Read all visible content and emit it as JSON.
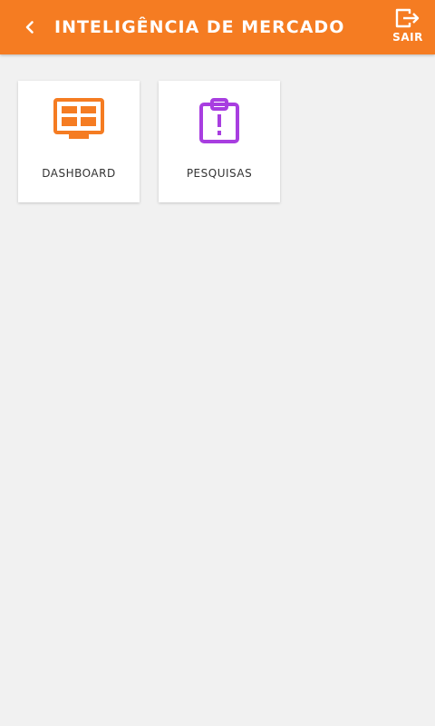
{
  "header": {
    "title": "INTELIGÊNCIA DE MERCADO",
    "back_icon": "chevron-left-icon",
    "logout_icon": "logout-icon",
    "logout_label": "SAIR",
    "background_color": "#f57c22"
  },
  "tiles": [
    {
      "label": "DASHBOARD",
      "icon": "dashboard-icon",
      "color": "#f57c22"
    },
    {
      "label": "PESQUISAS",
      "icon": "clipboard-alert-icon",
      "color": "#a83ee0"
    }
  ]
}
